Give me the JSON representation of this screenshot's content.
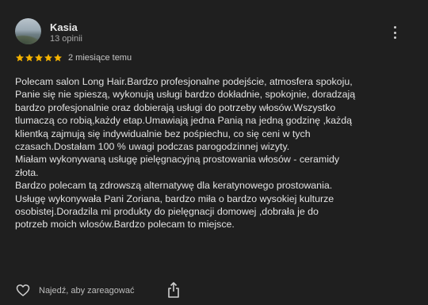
{
  "reviewer": {
    "name": "Kasia",
    "reviews_count": "13 opinii"
  },
  "rating": {
    "stars": 5,
    "max": 5,
    "star_color": "#f5b300",
    "date": "2 miesiące temu"
  },
  "review": {
    "lines": [
      "Polecam salon Long Hair.Bardzo profesjonalne podejście, atmosfera spokoju,",
      "Panie się nie spieszą, wykonują usługi bardzo dokładnie, spokojnie, doradzają",
      "bardzo profesjonalnie oraz dobierają usługi do potrzeby włosów.Wszystko",
      "tlumaczą co robią,każdy etap.Umawiają jedna Panią na jedną godzinę ,każdą",
      "klientką zajmują się indywidualnie bez pośpiechu, co się ceni w tych",
      "czasach.Dostałam 100 % uwagi podczas parogodzinnej wizyty.",
      "Miałam wykonywaną usługę pielęgnacyjną prostowania włosów - ceramidy",
      "złota.",
      "Bardzo polecam tą zdrowszą alternatywę dla keratynowego prostowania.",
      "Usługę wykonywała Pani Zoriana, bardzo miła o bardzo wysokiej kulturze",
      "osobistej.Doradzila mi produkty do pielęgnacji domowej ,dobrała je do",
      "potrzeb moich wlosów.Bardzo polecam to miejsce."
    ]
  },
  "actions": {
    "react_label": "Najedź, aby zareagować",
    "heart_icon": "heart-outline-icon",
    "share_icon": "share-icon",
    "more_icon": "more-vertical-icon"
  }
}
